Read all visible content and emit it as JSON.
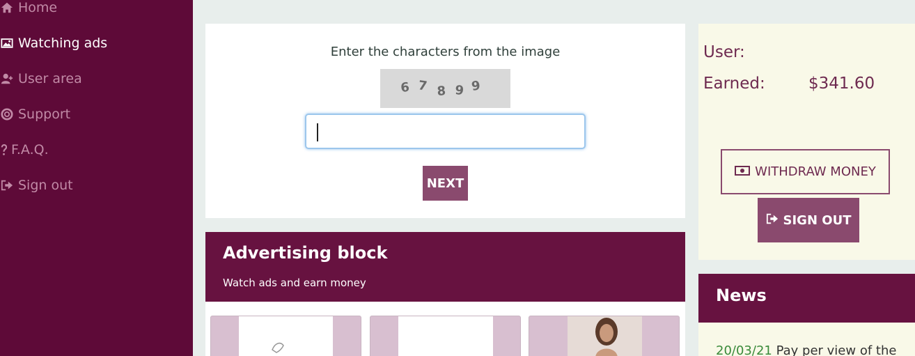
{
  "sidebar": {
    "items": [
      {
        "label": "Home",
        "icon": "home-icon"
      },
      {
        "label": "Watching ads",
        "icon": "image-icon",
        "active": true
      },
      {
        "label": "User area",
        "icon": "user-plus-icon"
      },
      {
        "label": "Support",
        "icon": "lifebuoy-icon"
      },
      {
        "label": "F.A.Q.",
        "icon": "question-icon"
      },
      {
        "label": "Sign out",
        "icon": "sign-out-icon"
      }
    ]
  },
  "captcha": {
    "prompt": "Enter the characters from the image",
    "image_text": "67899",
    "input_value": "",
    "next_label": "NEXT"
  },
  "advertising": {
    "title": "Advertising block",
    "subtitle": "Watch ads and earn money"
  },
  "user_panel": {
    "user_label": "User:",
    "earned_label": "Earned:",
    "earned_value": "$341.60",
    "withdraw_label": "WITHDRAW MONEY",
    "signout_label": "SIGN OUT"
  },
  "news": {
    "title": "News",
    "items": [
      {
        "date": "20/03/21",
        "text": "Pay per view of the"
      }
    ]
  },
  "colors": {
    "sidebar_bg": "#5e0a38",
    "accent": "#8a4a6e",
    "header_bg": "#671240",
    "panel_bg": "#f9f9e8",
    "page_bg": "#e8eeec"
  }
}
